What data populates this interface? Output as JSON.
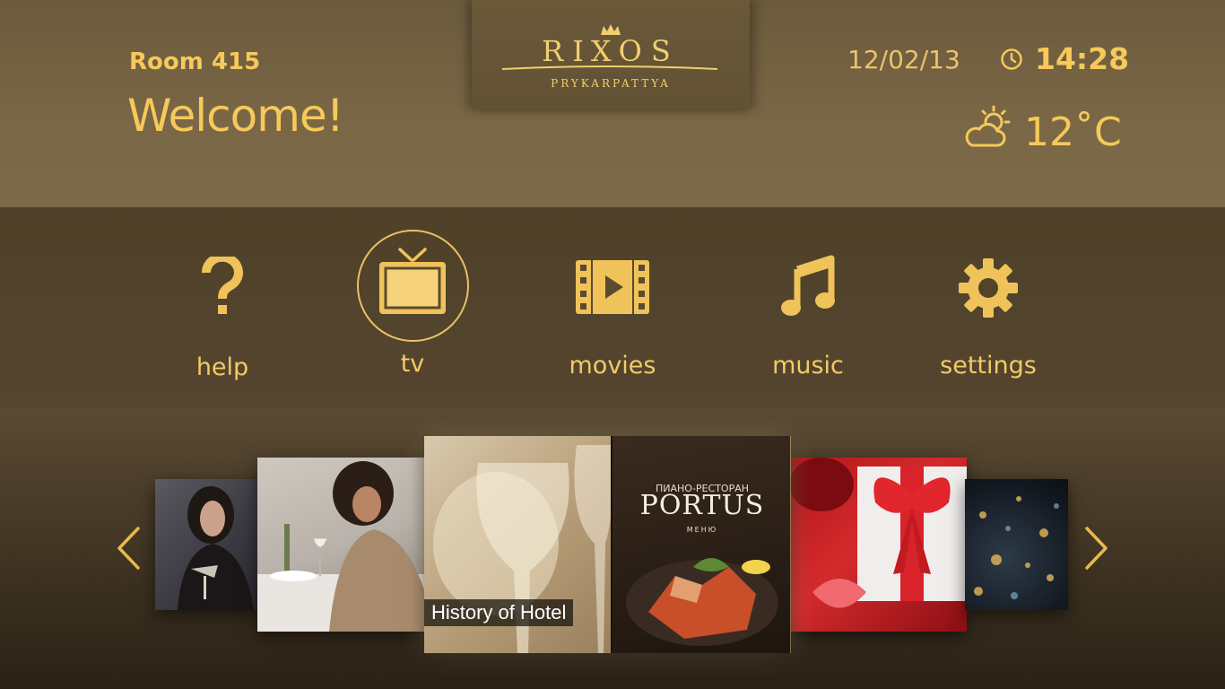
{
  "header": {
    "room": "Room 415",
    "greeting": "Welcome!",
    "date": "12/02/13",
    "time": "14:28",
    "temperature": "12˚C",
    "weather_icon": "partly-cloudy-icon"
  },
  "logo": {
    "brand": "RIXOS",
    "brand_prefix": "RI",
    "brand_x": "X",
    "brand_suffix": "OS",
    "location": "PRYKARPATTYA"
  },
  "menu": {
    "items": [
      {
        "label": "help",
        "icon": "question-icon"
      },
      {
        "label": "tv",
        "icon": "tv-icon",
        "selected": true
      },
      {
        "label": "movies",
        "icon": "film-play-icon"
      },
      {
        "label": "music",
        "icon": "music-note-icon"
      },
      {
        "label": "settings",
        "icon": "gear-icon"
      }
    ]
  },
  "carousel": {
    "featured_label": "History of Hotel",
    "menu_card": {
      "subtitle": "ПИАНО-РЕСТОРАН",
      "title": "PORTUS",
      "caption": "МЕНЮ"
    }
  },
  "colors": {
    "gold": "#f6c95a",
    "header_bg": "#7a6746",
    "menu_bg": "#524329"
  }
}
